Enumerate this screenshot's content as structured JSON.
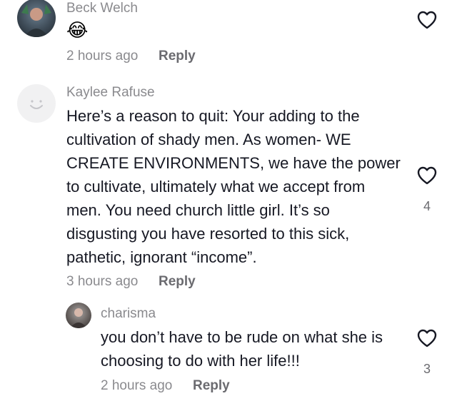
{
  "comments": [
    {
      "username": "Beck Welch",
      "text": "😂",
      "time": "2 hours ago",
      "reply_label": "Reply",
      "like_count": ""
    },
    {
      "username": "Kaylee Rafuse",
      "text_lines": [
        "Here’s a reason to quit: Your adding to the",
        "cultivation of shady men. As women- WE",
        "CREATE ENVIRONMENTS, we have the power",
        "to cultivate, ultimately what we accept from",
        "men. You need church little girl. It’s so",
        "disgusting you have resorted to this sick,",
        "pathetic, ignorant “income”."
      ],
      "time": "3 hours ago",
      "reply_label": "Reply",
      "like_count": "4"
    },
    {
      "username": "charisma",
      "text_lines": [
        "you don’t have to be rude on what she is",
        "choosing to do with her life!!!"
      ],
      "time": "2 hours ago",
      "reply_label": "Reply",
      "like_count": "3"
    }
  ],
  "icons": {
    "like": "heart-outline-icon",
    "default_avatar": "smiley-placeholder-icon"
  },
  "colors": {
    "text": "#161823",
    "muted": "#8a8a8e",
    "heart_outline": "#161823"
  }
}
